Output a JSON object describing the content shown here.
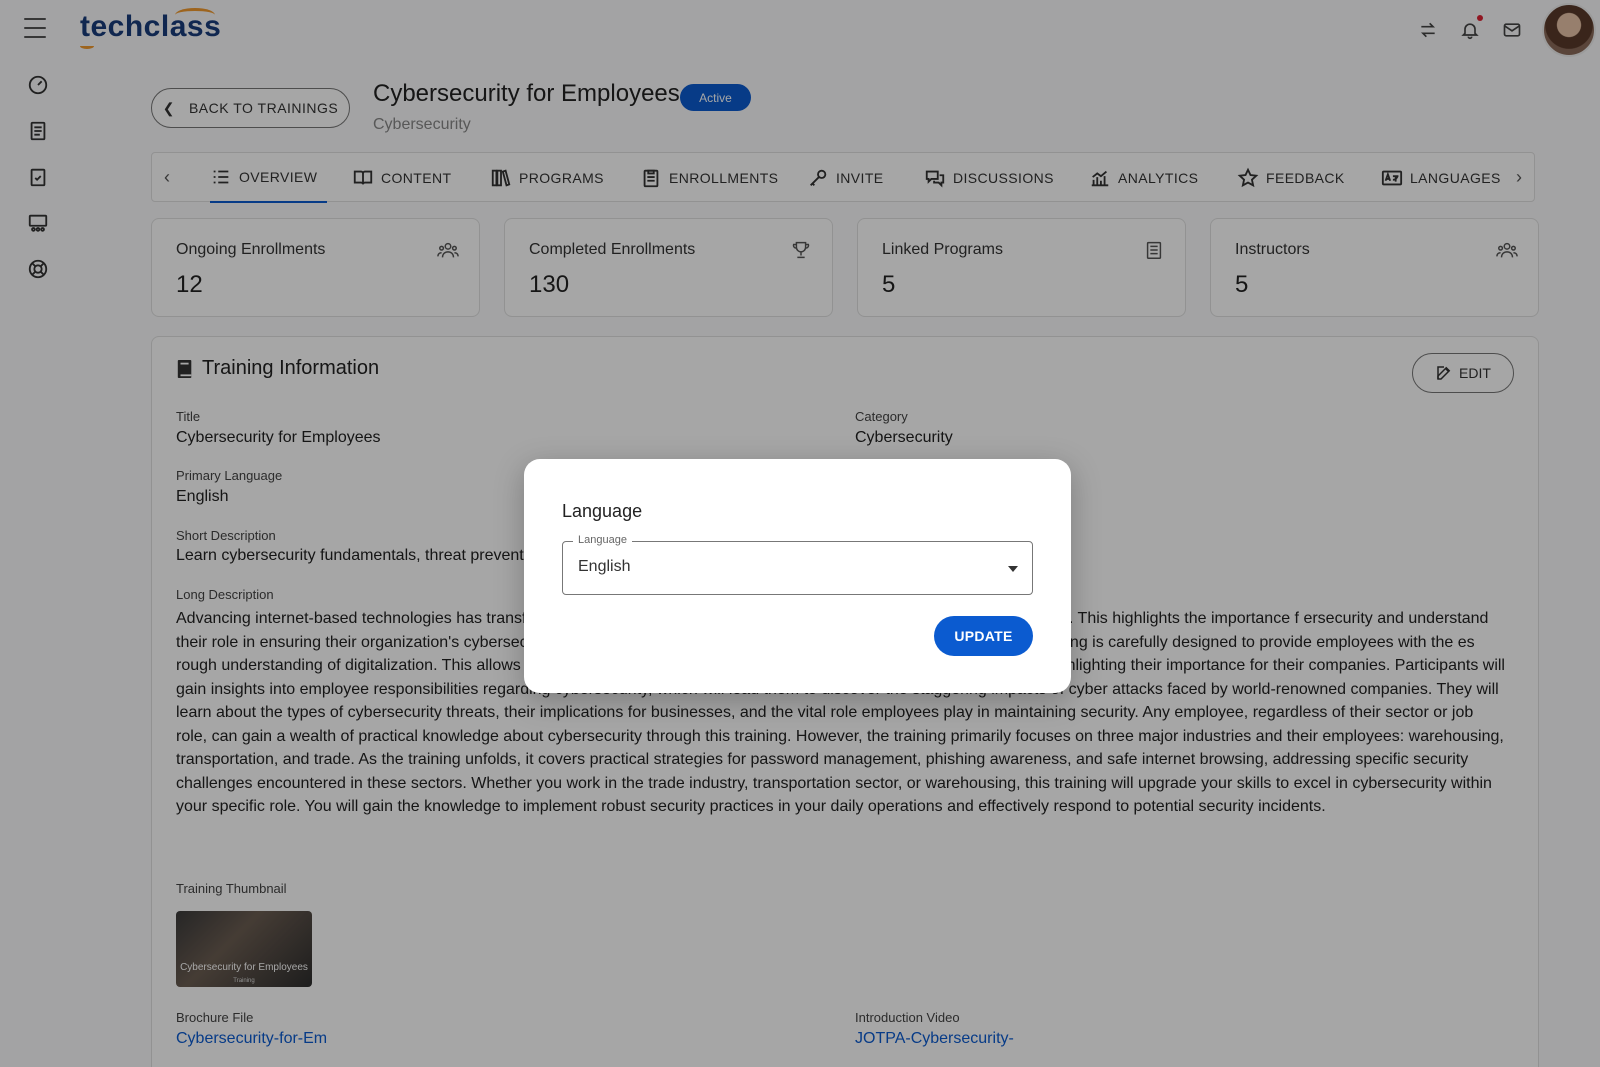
{
  "app": {
    "logo_text": "techclass",
    "brand_color": "#1a3d7c",
    "accent_color": "#f29a2e",
    "primary_color": "#0b5bd0"
  },
  "topbar": {
    "icons": [
      "switch-icon",
      "bell-icon",
      "mail-icon"
    ]
  },
  "sidebar": {
    "icons": [
      "dashboard-icon",
      "book-icon",
      "clipboard-check-icon",
      "classroom-icon",
      "lifebuoy-icon"
    ]
  },
  "header": {
    "back_label": "BACK TO TRAININGS",
    "title": "Cybersecurity for Employees",
    "status": "Active",
    "subtitle": "Cybersecurity"
  },
  "tabs": [
    {
      "label": "OVERVIEW",
      "icon": "list-icon",
      "active": true
    },
    {
      "label": "CONTENT",
      "icon": "open-book-icon"
    },
    {
      "label": "PROGRAMS",
      "icon": "books-icon"
    },
    {
      "label": "ENROLLMENTS",
      "icon": "clipboard-icon"
    },
    {
      "label": "INVITE",
      "icon": "key-icon"
    },
    {
      "label": "DISCUSSIONS",
      "icon": "chat-icon"
    },
    {
      "label": "ANALYTICS",
      "icon": "chart-icon"
    },
    {
      "label": "FEEDBACK",
      "icon": "star-icon"
    },
    {
      "label": "LANGUAGES",
      "icon": "language-icon"
    }
  ],
  "stats": [
    {
      "label": "Ongoing Enrollments",
      "value": "12",
      "icon": "users-icon"
    },
    {
      "label": "Completed Enrollments",
      "value": "130",
      "icon": "trophy-icon"
    },
    {
      "label": "Linked Programs",
      "value": "5",
      "icon": "document-icon"
    },
    {
      "label": "Instructors",
      "value": "5",
      "icon": "users-icon"
    }
  ],
  "info": {
    "section_title": "Training Information",
    "edit_label": "EDIT",
    "title_label": "Title",
    "title_value": "Cybersecurity for Employees",
    "category_label": "Category",
    "category_value": "Cybersecurity",
    "primary_language_label": "Primary Language",
    "primary_language_value": "English",
    "short_desc_label": "Short Description",
    "short_desc_value": "Learn cybersecurity fundamentals, threat preventic",
    "long_desc_label": "Long Description",
    "long_desc_value": "Advancing internet-based technologies has transfo a prioritization of measures against the cyber threats that accompany them. This highlights the importance f ersecurity and understand their role in ensuring their organization's cybersecurity. Recognizing the dem it, TechClass's Cybersecurity for Employees training is carefully designed to provide employees with the es rough understanding of digitalization. This allows them to delve into the concepts of information security and cybersecurity, highlighting their importance for their companies. Participants will gain insights into employee responsibilities regarding cybersecurity, which will lead them to discover the staggering impacts of cyber attacks faced by world-renowned companies. They will learn about the types of cybersecurity threats, their implications for businesses, and the vital role employees play in maintaining security. Any employee, regardless of their sector or job role, can gain a wealth of practical knowledge about cybersecurity through this training. However, the training primarily focuses on three major industries and their employees: warehousing, transportation, and trade. As the training unfolds, it covers practical strategies for password management, phishing awareness, and safe internet browsing, addressing specific security challenges encountered in these sectors. Whether you work in the trade industry, transportation sector, or warehousing, this training will upgrade your skills to excel in cybersecurity within your specific role. You will gain the knowledge to implement robust security practices in your daily operations and effectively respond to potential security incidents.",
    "thumbnail_label": "Training Thumbnail",
    "thumbnail_caption": "Cybersecurity for Employees",
    "thumbnail_sub": "Training",
    "brochure_label": "Brochure File",
    "brochure_value": "Cybersecurity-for-Em",
    "video_label": "Introduction Video",
    "video_value": "JOTPA-Cybersecurity-"
  },
  "modal": {
    "title": "Language",
    "field_label": "Language",
    "field_value": "English",
    "update_label": "UPDATE"
  }
}
